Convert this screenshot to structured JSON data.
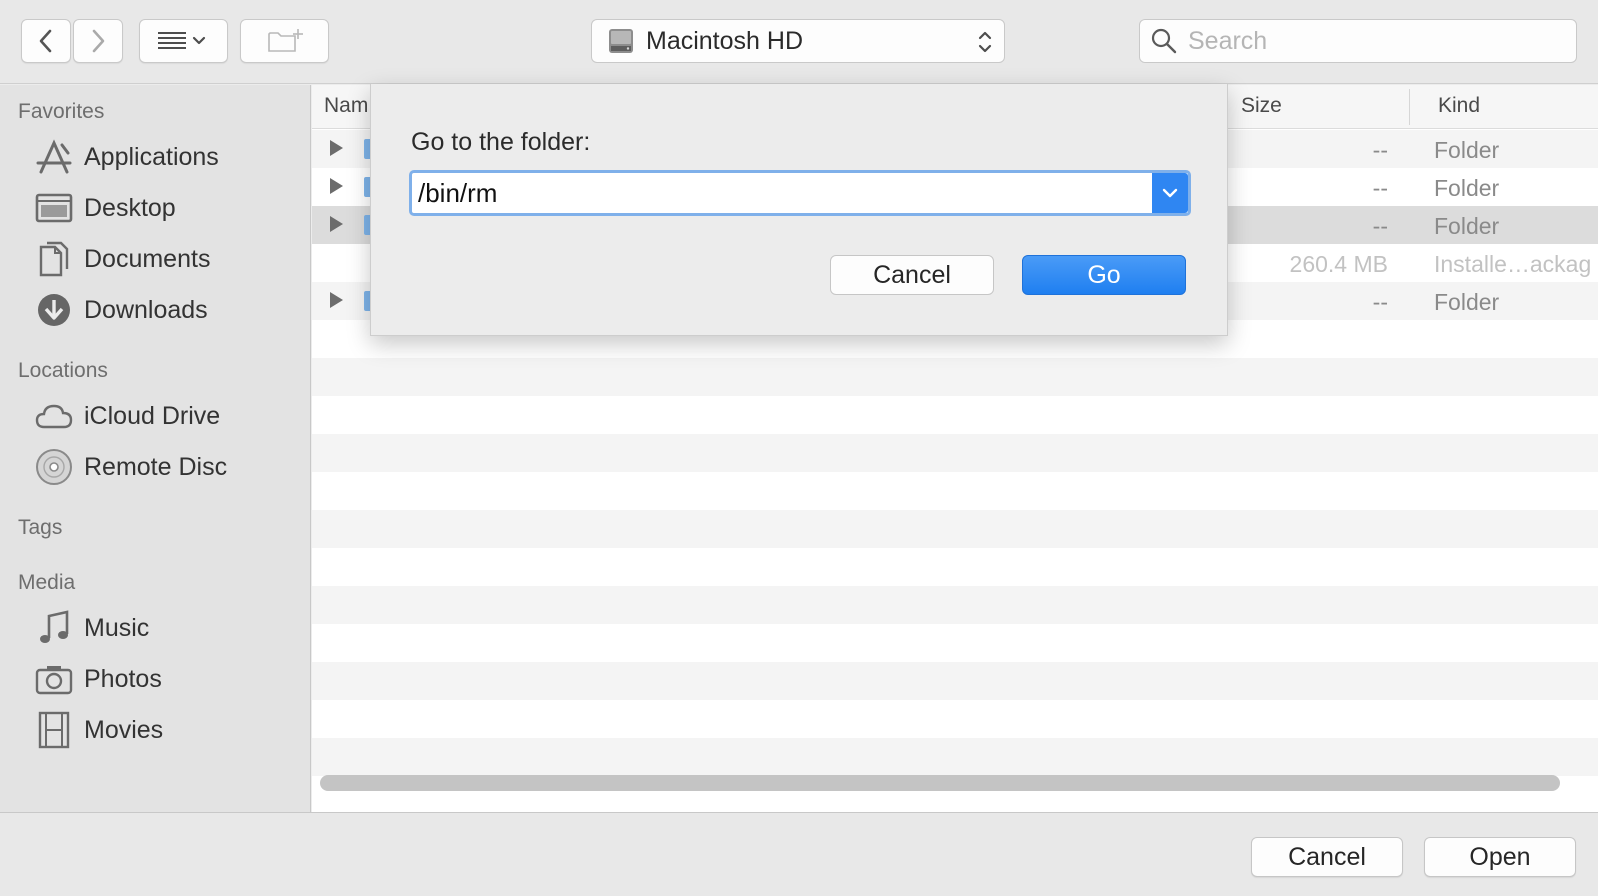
{
  "toolbar": {
    "location": "Macintosh HD",
    "search_placeholder": "Search"
  },
  "sidebar": {
    "favorites_title": "Favorites",
    "favorites": [
      {
        "label": "Applications",
        "icon": "applications-icon"
      },
      {
        "label": "Desktop",
        "icon": "desktop-icon"
      },
      {
        "label": "Documents",
        "icon": "documents-icon"
      },
      {
        "label": "Downloads",
        "icon": "downloads-icon"
      }
    ],
    "locations_title": "Locations",
    "locations": [
      {
        "label": "iCloud Drive",
        "icon": "icloud-icon"
      },
      {
        "label": "Remote Disc",
        "icon": "disc-icon"
      }
    ],
    "tags_title": "Tags",
    "media_title": "Media",
    "media": [
      {
        "label": "Music",
        "icon": "music-icon"
      },
      {
        "label": "Photos",
        "icon": "camera-icon"
      },
      {
        "label": "Movies",
        "icon": "film-icon"
      }
    ]
  },
  "list": {
    "columns": {
      "name": "Nam",
      "size": "Size",
      "kind": "Kind"
    },
    "rows": [
      {
        "size": "--",
        "kind": "Folder"
      },
      {
        "size": "--",
        "kind": "Folder"
      },
      {
        "size": "--",
        "kind": "Folder"
      },
      {
        "size": "260.4 MB",
        "kind": "Installe…ackag"
      },
      {
        "size": "--",
        "kind": "Folder"
      }
    ]
  },
  "sheet": {
    "prompt": "Go to the folder:",
    "path_value": "/bin/rm",
    "cancel_label": "Cancel",
    "go_label": "Go"
  },
  "bottom": {
    "cancel_label": "Cancel",
    "open_label": "Open"
  },
  "colors": {
    "accent": "#2f86f2",
    "selection": "#dcdcdc",
    "folder": "#7eb4ea"
  }
}
